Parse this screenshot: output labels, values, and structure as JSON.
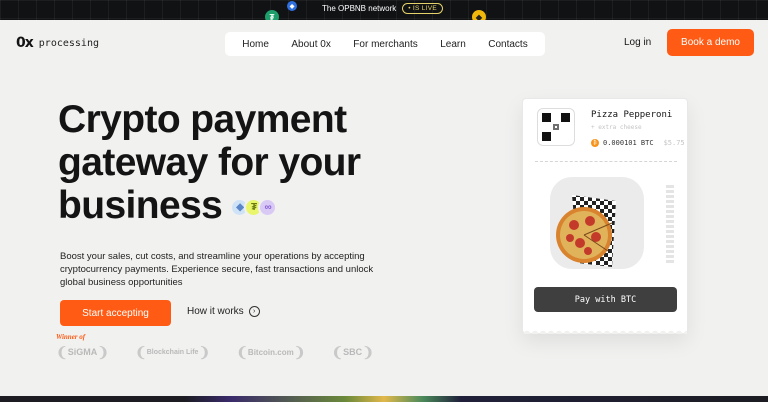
{
  "announcement": {
    "text": "The OPBNB network",
    "badge": "• IS LIVE"
  },
  "brand": {
    "mark": "0x",
    "name": "processing"
  },
  "nav": {
    "items": [
      "Home",
      "About 0x",
      "For merchants",
      "Learn",
      "Contacts"
    ]
  },
  "header": {
    "login_label": "Log in",
    "demo_label": "Book a demo"
  },
  "hero": {
    "title_lines": [
      "Crypto payment",
      "gateway for your",
      "business"
    ],
    "description": "Boost your sales, cut costs, and streamline your operations by accepting cryptocurrency payments. Experience secure, fast transactions and unlock global business opportunities",
    "primary_cta": "Start accepting",
    "secondary_cta": "How it works"
  },
  "awards": {
    "winner_label": "Winner of",
    "items": [
      "SiGMA",
      "Blockchain Life",
      "Bitcoin.com",
      "SBC"
    ]
  },
  "receipt": {
    "item_name": "Pizza Pepperoni",
    "item_sub": "+ extra cheese",
    "price_crypto": "0.000101 BTC",
    "price_fiat": "$5.75",
    "pay_label": "Pay with BTC"
  },
  "colors": {
    "accent": "#ff5b14",
    "background": "#f1f1f0",
    "pay_button": "#3f3f3f"
  }
}
